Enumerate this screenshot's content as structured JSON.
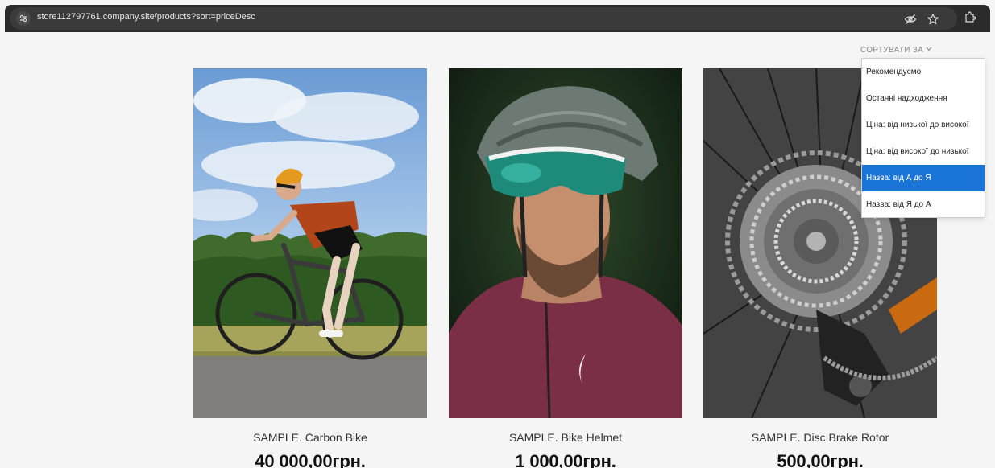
{
  "browser": {
    "url": "store112797761.company.site/products?sort=priceDesc"
  },
  "sort": {
    "label": "СОРТУВАТИ ЗА",
    "options": [
      "Рекомендуємо",
      "Останні надходження",
      "Ціна: від низької до високої",
      "Ціна: від високої до низької",
      "Назва: від А до Я",
      "Назва: від Я до А"
    ],
    "selected_index": 4
  },
  "products": [
    {
      "name": "SAMPLE. Carbon Bike",
      "price": "40 000,00грн."
    },
    {
      "name": "SAMPLE. Bike Helmet",
      "price": "1 000,00грн."
    },
    {
      "name": "SAMPLE. Disc Brake Rotor",
      "price": "500,00грн."
    }
  ],
  "colors": {
    "browser_bar": "#2b2b2b",
    "selected_option": "#1a73d6",
    "page_bg": "#f5f5f5"
  }
}
